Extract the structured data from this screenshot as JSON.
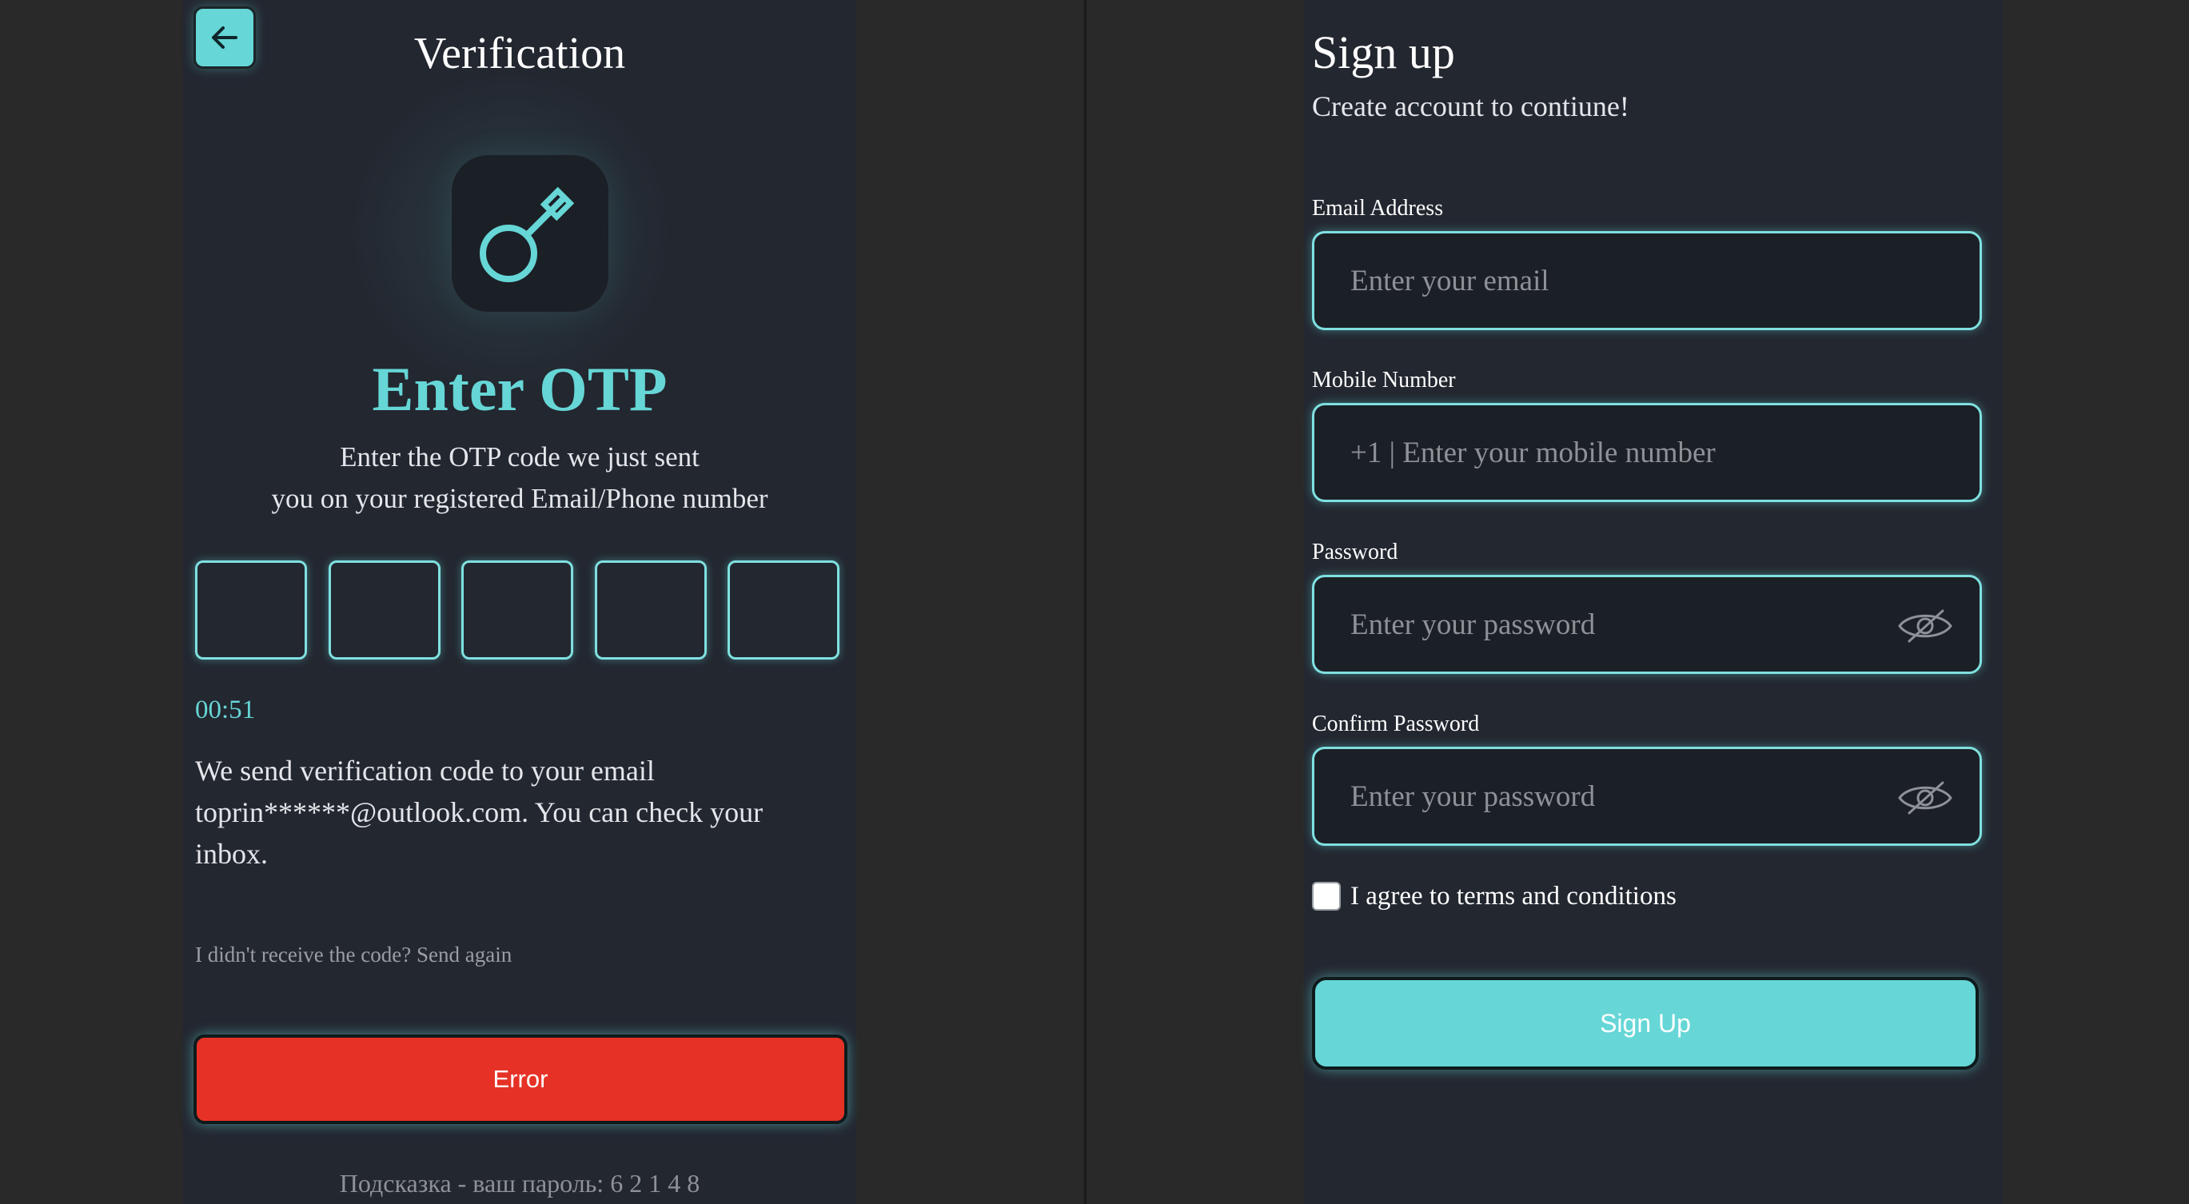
{
  "verification": {
    "title": "Verification",
    "back_icon": "arrow-left-icon",
    "key_icon": "key-icon",
    "heading": "Enter OTP",
    "description_line1": "Enter the OTP code we just sent",
    "description_line2": "you on your registered Email/Phone number",
    "otp_digits": [
      "",
      "",
      "",
      "",
      ""
    ],
    "timer": "00:51",
    "info_text": "We send verification code to your email toprin******@outlook.com. You can check your inbox.",
    "resend_text": "I didn't receive the code? Send again",
    "error_button_label": "Error",
    "hint": "Подсказка - ваш пароль: 6 2 1 4 8"
  },
  "signup": {
    "title": "Sign up",
    "subtitle": "Create account to contiune!",
    "email_label": "Email Address",
    "email_placeholder": "Enter your email",
    "mobile_label": "Mobile Number",
    "mobile_placeholder": "+1 | Enter your mobile number",
    "password_label": "Password",
    "password_placeholder": "Enter your password",
    "confirm_password_label": "Confirm Password",
    "confirm_password_placeholder": "Enter your password",
    "eye_icon": "eye-off-icon",
    "terms_label": "I agree to terms and conditions",
    "terms_checked": false,
    "signup_button_label": "Sign Up"
  },
  "colors": {
    "accent": "#66d6d6",
    "error": "#e63226",
    "panel_bg": "#232730",
    "page_bg": "#292929"
  }
}
